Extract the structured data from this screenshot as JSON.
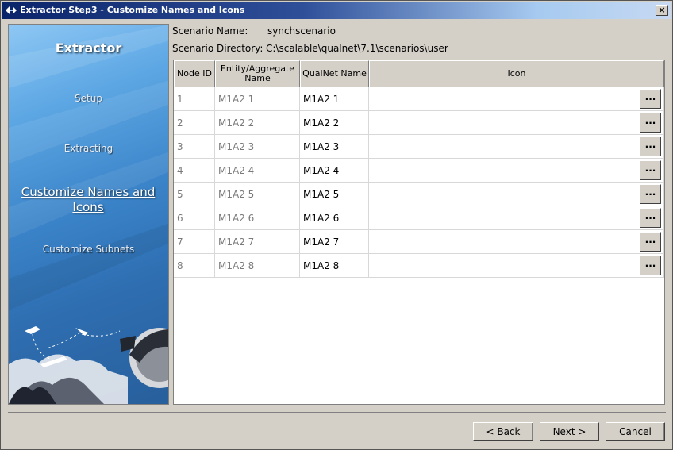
{
  "window": {
    "title": "Extractor Step3 - Customize Names and Icons",
    "close_label": "×"
  },
  "sidebar": {
    "title": "Extractor",
    "steps": [
      {
        "label": "Setup",
        "active": false
      },
      {
        "label": "Extracting",
        "active": false
      },
      {
        "label": "Customize Names and Icons",
        "active": true
      },
      {
        "label": "Customize Subnets",
        "active": false
      }
    ]
  },
  "scenario": {
    "name_label": "Scenario Name:",
    "name_value": "synchscenario",
    "dir_label": "Scenario Directory:",
    "dir_value": "C:\\scalable\\qualnet\\7.1\\scenarios\\user"
  },
  "table": {
    "headers": [
      "Node ID",
      "Entity/Aggregate Name",
      "QualNet Name",
      "Icon"
    ],
    "rows": [
      {
        "id": "1",
        "entity": "M1A2 1",
        "qualnet": "M1A2 1",
        "icon": ""
      },
      {
        "id": "2",
        "entity": "M1A2 2",
        "qualnet": "M1A2 2",
        "icon": ""
      },
      {
        "id": "3",
        "entity": "M1A2 3",
        "qualnet": "M1A2 3",
        "icon": ""
      },
      {
        "id": "4",
        "entity": "M1A2 4",
        "qualnet": "M1A2 4",
        "icon": ""
      },
      {
        "id": "5",
        "entity": "M1A2 5",
        "qualnet": "M1A2 5",
        "icon": ""
      },
      {
        "id": "6",
        "entity": "M1A2 6",
        "qualnet": "M1A2 6",
        "icon": ""
      },
      {
        "id": "7",
        "entity": "M1A2 7",
        "qualnet": "M1A2 7",
        "icon": ""
      },
      {
        "id": "8",
        "entity": "M1A2 8",
        "qualnet": "M1A2 8",
        "icon": ""
      }
    ],
    "browse_label": "..."
  },
  "buttons": {
    "back": "< Back",
    "next": "Next >",
    "cancel": "Cancel"
  },
  "colors": {
    "titlebar_start": "#0a246a",
    "sidebar_blue": "#3b84c9"
  }
}
